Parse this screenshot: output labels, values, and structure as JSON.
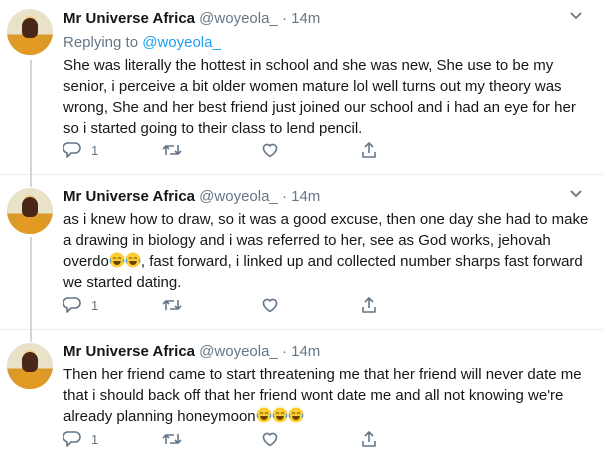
{
  "tweets": [
    {
      "name": "Mr Universe Africa",
      "handle": "@woyeola_",
      "dot": "·",
      "time": "14m",
      "replying_label": "Replying to",
      "replying_handle": "@woyeola_",
      "text": "She was literally the hottest in school and she was new, She use to be my senior, i perceive a bit older women mature lol well turns out my theory was wrong, She and her best friend just joined our school and i had an eye for her so i started going to their class to lend pencil.",
      "reply_count": "1"
    },
    {
      "name": "Mr Universe Africa",
      "handle": "@woyeola_",
      "dot": "·",
      "time": "14m",
      "text_a": "as i knew how to draw, so it was a good excuse, then one day she had to make a drawing in biology and i was referred to her, see as God works, jehovah overdo",
      "text_b": ", fast forward, i linked up and collected number sharps fast forward we started dating.",
      "reply_count": "1"
    },
    {
      "name": "Mr Universe Africa",
      "handle": "@woyeola_",
      "dot": "·",
      "time": "14m",
      "text": "Then her friend came to start threatening me that her friend will never date me that i should back off that her friend wont date me and all not knowing we're already planning honeymoon",
      "reply_count": "1"
    }
  ],
  "icons": {
    "emoji": "face-with-tears-of-joy",
    "accent": "#1da1f2",
    "muted": "#657786"
  }
}
